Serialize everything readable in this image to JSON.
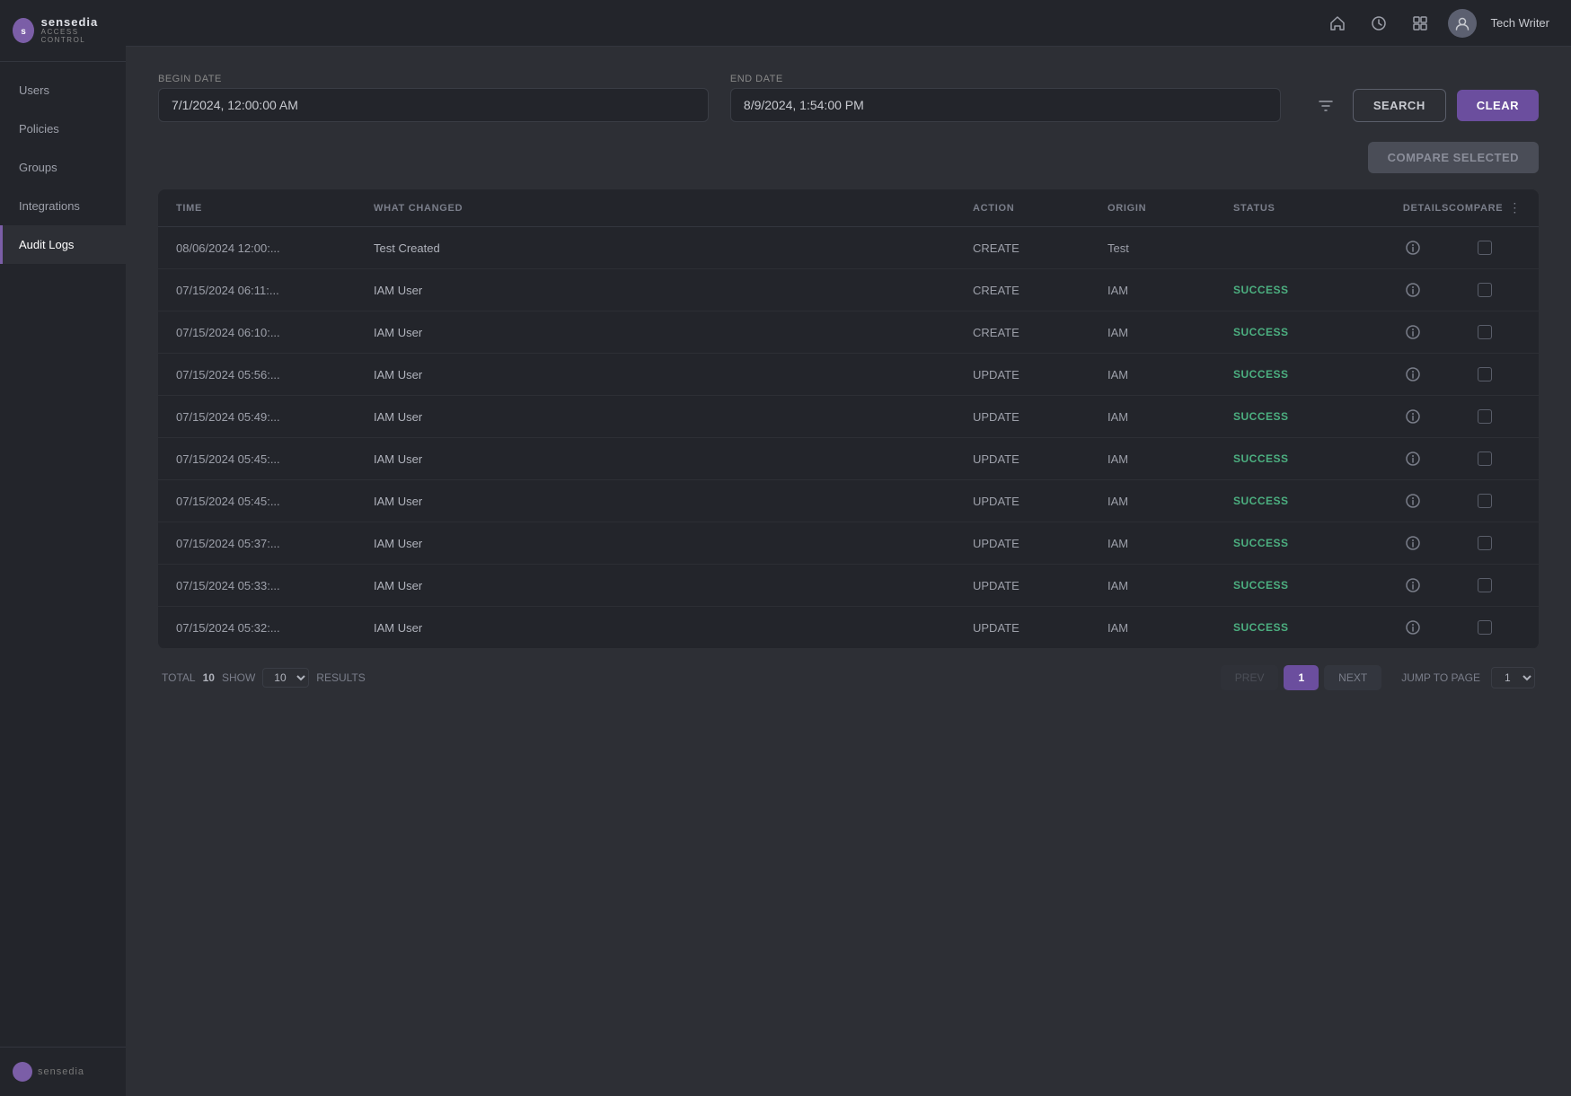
{
  "sidebar": {
    "logo": {
      "icon": "S",
      "name": "sensedia",
      "sub": "ACCESS CONTROL"
    },
    "items": [
      {
        "id": "users",
        "label": "Users",
        "active": false
      },
      {
        "id": "policies",
        "label": "Policies",
        "active": false
      },
      {
        "id": "groups",
        "label": "Groups",
        "active": false
      },
      {
        "id": "integrations",
        "label": "Integrations",
        "active": false
      },
      {
        "id": "audit-logs",
        "label": "Audit Logs",
        "active": true
      }
    ],
    "bottom_logo": "sensedia"
  },
  "topbar": {
    "icons": [
      "home",
      "clock",
      "grid"
    ],
    "username": "Tech Writer"
  },
  "filters": {
    "begin_date_label": "Begin Date",
    "begin_date_value": "7/1/2024, 12:00:00 AM",
    "end_date_label": "End Date",
    "end_date_value": "8/9/2024, 1:54:00 PM",
    "search_btn": "SEARCH",
    "clear_btn": "CLEAR"
  },
  "compare_btn": "COMPARE SELECTED",
  "table": {
    "columns": [
      {
        "id": "time",
        "label": "TIME"
      },
      {
        "id": "what_changed",
        "label": "WHAT CHANGED"
      },
      {
        "id": "action",
        "label": "ACTION"
      },
      {
        "id": "origin",
        "label": "ORIGIN"
      },
      {
        "id": "status",
        "label": "STATUS"
      },
      {
        "id": "details",
        "label": "DETAILS"
      },
      {
        "id": "compare",
        "label": "COMPARE"
      }
    ],
    "rows": [
      {
        "time": "08/06/2024 12:00:...",
        "what_changed": "Test Created",
        "action": "CREATE",
        "origin": "Test",
        "status": ""
      },
      {
        "time": "07/15/2024 06:11:...",
        "what_changed": "IAM User",
        "action": "CREATE",
        "origin": "IAM",
        "status": "SUCCESS"
      },
      {
        "time": "07/15/2024 06:10:...",
        "what_changed": "IAM User",
        "action": "CREATE",
        "origin": "IAM",
        "status": "SUCCESS"
      },
      {
        "time": "07/15/2024 05:56:...",
        "what_changed": "IAM User",
        "action": "UPDATE",
        "origin": "IAM",
        "status": "SUCCESS"
      },
      {
        "time": "07/15/2024 05:49:...",
        "what_changed": "IAM User",
        "action": "UPDATE",
        "origin": "IAM",
        "status": "SUCCESS"
      },
      {
        "time": "07/15/2024 05:45:...",
        "what_changed": "IAM User",
        "action": "UPDATE",
        "origin": "IAM",
        "status": "SUCCESS"
      },
      {
        "time": "07/15/2024 05:45:...",
        "what_changed": "IAM User",
        "action": "UPDATE",
        "origin": "IAM",
        "status": "SUCCESS"
      },
      {
        "time": "07/15/2024 05:37:...",
        "what_changed": "IAM User",
        "action": "UPDATE",
        "origin": "IAM",
        "status": "SUCCESS"
      },
      {
        "time": "07/15/2024 05:33:...",
        "what_changed": "IAM User",
        "action": "UPDATE",
        "origin": "IAM",
        "status": "SUCCESS"
      },
      {
        "time": "07/15/2024 05:32:...",
        "what_changed": "IAM User",
        "action": "UPDATE",
        "origin": "IAM",
        "status": "SUCCESS"
      }
    ]
  },
  "pagination": {
    "total_label": "TOTAL",
    "total_value": "10",
    "show_label": "SHOW",
    "show_value": "10",
    "results_label": "RESULTS",
    "prev_label": "PREV",
    "current_page": "1",
    "next_label": "NEXT",
    "jump_label": "JUMP TO PAGE",
    "jump_value": "1"
  }
}
